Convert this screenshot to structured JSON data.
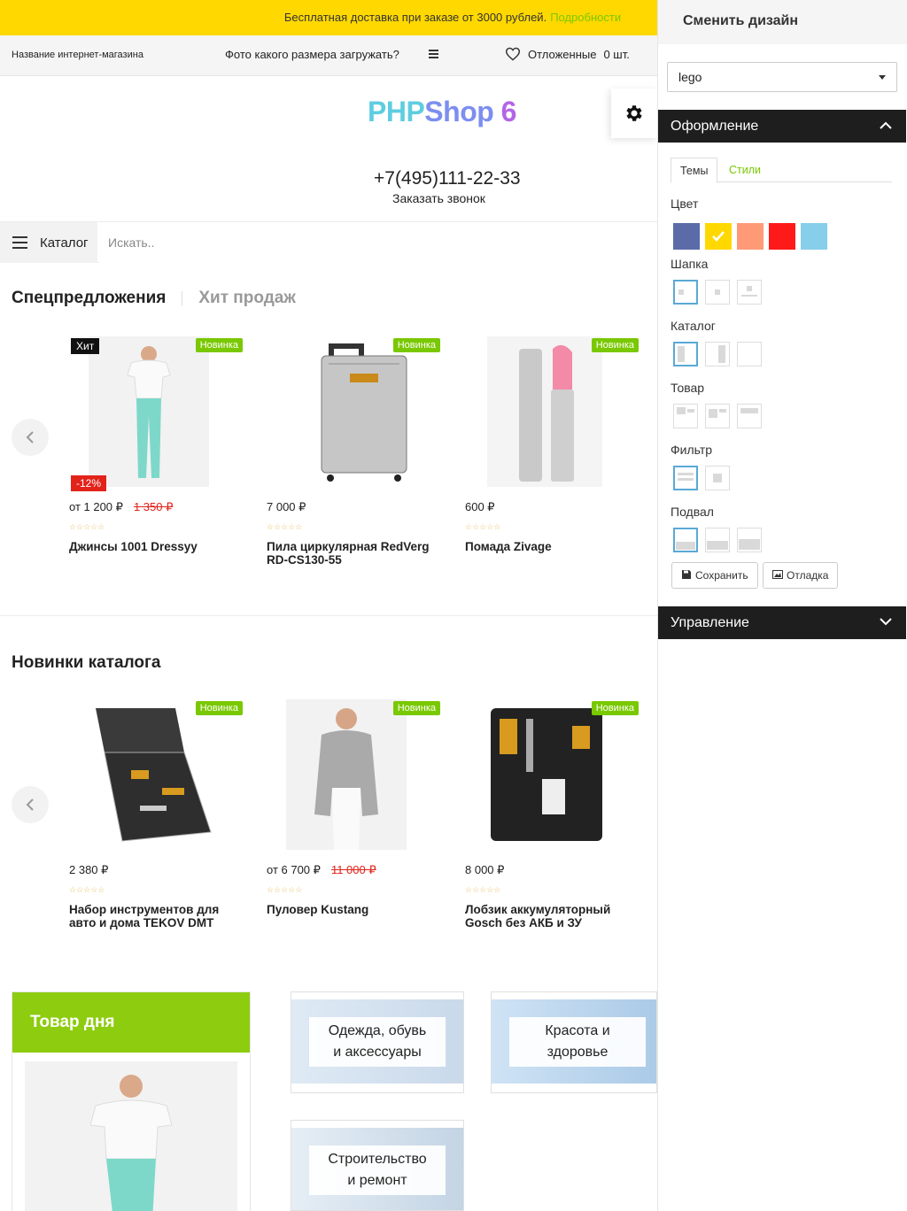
{
  "promo": {
    "text": "Бесплатная доставка при заказе от 3000 рублей.",
    "link": "Подробности"
  },
  "topbar": {
    "shop_name": "Название интернет-магазина",
    "photo_question": "Фото какого размера загружать?",
    "wishlist": "Отложенные",
    "wishlist_count": "0 шт."
  },
  "logo": {
    "part1": "PHP",
    "part2": "Shop",
    "part3": " 6"
  },
  "contacts": {
    "phone": "+7(495)111-22-33",
    "callback": "Заказать звонок"
  },
  "catalog_bar": {
    "catalog_label": "Каталог",
    "search_placeholder": "Искать.."
  },
  "special_tabs": {
    "active": "Спецпредложения",
    "inactive": "Хит продаж"
  },
  "special_products": [
    {
      "name": "Джинсы 1001 Dressyy",
      "price": "от 1 200 ₽",
      "old_price": "1 350 ₽",
      "badge_new": "Новинка",
      "badge_hit": "Хит",
      "badge_sale": "-12%"
    },
    {
      "name": "Пила циркулярная RedVerg RD-CS130-55",
      "price": "7 000 ₽",
      "badge_new": "Новинка"
    },
    {
      "name": "Помада Zivage",
      "price": "600 ₽",
      "badge_new": "Новинка"
    }
  ],
  "new_section_title": "Новинки каталога",
  "new_products": [
    {
      "name": "Набор инструментов для авто и дома TEKOV DMT",
      "price": "2 380 ₽",
      "badge_new": "Новинка"
    },
    {
      "name": "Пуловер Kustang",
      "price": "от 6 700 ₽",
      "old_price": "11 000 ₽",
      "badge_new": "Новинка"
    },
    {
      "name": "Лобзик аккумуляторный Gosch без АКБ и ЗУ",
      "price": "8 000 ₽",
      "badge_new": "Новинка"
    }
  ],
  "day_product": {
    "title": "Товар дня"
  },
  "categories": [
    {
      "line1": "Одежда, обувь",
      "line2": "и аксессуары"
    },
    {
      "line1": "Красота и",
      "line2": "здоровье"
    },
    {
      "line1": "Строительство",
      "line2": "и ремонт"
    }
  ],
  "panel": {
    "title": "Сменить дизайн",
    "design_value": "lego",
    "section_design": "Оформление",
    "tab_themes": "Темы",
    "tab_styles": "Стили",
    "label_color": "Цвет",
    "label_header": "Шапка",
    "label_catalog": "Каталог",
    "label_product": "Товар",
    "label_filter": "Фильтр",
    "label_footer": "Подвал",
    "save": "Сохранить",
    "debug": "Отладка",
    "section_manage": "Управление",
    "colors": [
      "#5b6ba8",
      "#ffd800",
      "#ff9a76",
      "#ff1a1a",
      "#87ceeb"
    ]
  }
}
